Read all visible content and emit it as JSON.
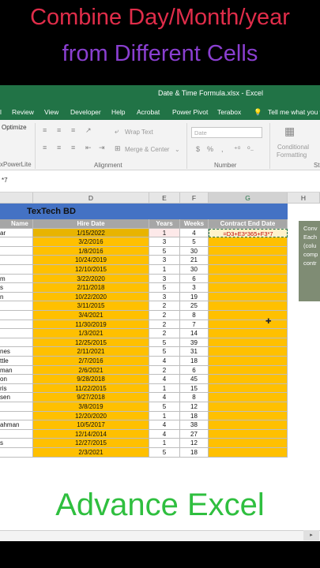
{
  "banner": {
    "line1": "Combine Day/Month/year",
    "line2": "from Different Cells"
  },
  "window": {
    "title": "Date & Time Formula.xlsx  -  Excel"
  },
  "tabs": [
    "Review",
    "View",
    "Developer",
    "Help",
    "Acrobat",
    "Power Pivot",
    "Terabox"
  ],
  "tell_me": "Tell me what you w",
  "ribbon": {
    "optimize": "Optimize",
    "powerlite": "xPowerLite",
    "wrap_text": "Wrap Text",
    "merge_center": "Merge & Center",
    "alignment": "Alignment",
    "number_format": "Date",
    "number": "Number",
    "conditional": "Conditional",
    "formatting": "Formatting",
    "st": "St"
  },
  "formula_bar": "*7",
  "columns": [
    "D",
    "E",
    "F",
    "G",
    "H"
  ],
  "sheet": {
    "title": "TexTech BD",
    "headers": {
      "name": "Name",
      "hire": "Hire Date",
      "years": "Years",
      "weeks": "Weeks",
      "contract": "Contract End Date"
    },
    "formula": "=D3+E3*365+F3*7",
    "rows": [
      {
        "name": "ar",
        "hire": "1/15/2022",
        "years": "1",
        "weeks": "4"
      },
      {
        "name": "",
        "hire": "3/2/2016",
        "years": "3",
        "weeks": "5"
      },
      {
        "name": "",
        "hire": "1/8/2016",
        "years": "5",
        "weeks": "30"
      },
      {
        "name": "",
        "hire": "10/24/2019",
        "years": "3",
        "weeks": "21"
      },
      {
        "name": "",
        "hire": "12/10/2015",
        "years": "1",
        "weeks": "30"
      },
      {
        "name": "m",
        "hire": "3/22/2020",
        "years": "3",
        "weeks": "6"
      },
      {
        "name": "s",
        "hire": "2/11/2018",
        "years": "5",
        "weeks": "3"
      },
      {
        "name": "n",
        "hire": "10/22/2020",
        "years": "3",
        "weeks": "19"
      },
      {
        "name": "",
        "hire": "3/11/2015",
        "years": "2",
        "weeks": "25"
      },
      {
        "name": "",
        "hire": "3/4/2021",
        "years": "2",
        "weeks": "8"
      },
      {
        "name": "",
        "hire": "11/30/2019",
        "years": "2",
        "weeks": "7"
      },
      {
        "name": "",
        "hire": "1/3/2021",
        "years": "2",
        "weeks": "14"
      },
      {
        "name": "",
        "hire": "12/25/2015",
        "years": "5",
        "weeks": "39"
      },
      {
        "name": "nes",
        "hire": "2/11/2021",
        "years": "5",
        "weeks": "31"
      },
      {
        "name": "ttle",
        "hire": "2/7/2016",
        "years": "4",
        "weeks": "18"
      },
      {
        "name": "man",
        "hire": "2/6/2021",
        "years": "2",
        "weeks": "6"
      },
      {
        "name": "on",
        "hire": "9/28/2018",
        "years": "4",
        "weeks": "45"
      },
      {
        "name": "ris",
        "hire": "11/22/2015",
        "years": "1",
        "weeks": "15"
      },
      {
        "name": "sen",
        "hire": "9/27/2018",
        "years": "4",
        "weeks": "8"
      },
      {
        "name": "",
        "hire": "3/8/2019",
        "years": "5",
        "weeks": "12"
      },
      {
        "name": "",
        "hire": "12/20/2020",
        "years": "1",
        "weeks": "18"
      },
      {
        "name": "ahman",
        "hire": "10/5/2017",
        "years": "4",
        "weeks": "38"
      },
      {
        "name": "",
        "hire": "12/14/2014",
        "years": "4",
        "weeks": "27"
      },
      {
        "name": "s",
        "hire": "12/27/2015",
        "years": "1",
        "weeks": "12"
      },
      {
        "name": "",
        "hire": "2/3/2021",
        "years": "5",
        "weeks": "18"
      }
    ]
  },
  "note": {
    "lines": [
      "Conv",
      "Each",
      "(colu",
      "comp",
      "contr"
    ]
  },
  "footer_text": "Advance Excel",
  "colors": {
    "excel_green": "#217346",
    "highlight": "#ffc000",
    "header_blue": "#4472c4",
    "banner_red": "#e12d4a",
    "banner_purple": "#8a3fd0",
    "footer_green": "#2fbf3f"
  }
}
